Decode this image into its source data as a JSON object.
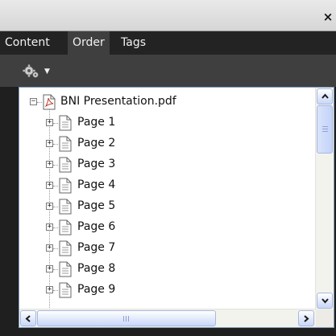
{
  "window": {
    "close_glyph": "×"
  },
  "tabs": [
    {
      "label": "Content",
      "active": false
    },
    {
      "label": "Order",
      "active": true
    },
    {
      "label": "Tags",
      "active": false
    }
  ],
  "toolbar": {
    "options_icon": "gear-icon",
    "caret_glyph": "▼"
  },
  "tree": {
    "root": {
      "label": "BNI Presentation.pdf",
      "expander": "−",
      "icon": "pdf-file-icon"
    },
    "items": [
      {
        "label": "Page 1",
        "expander": "+"
      },
      {
        "label": "Page 2",
        "expander": "+"
      },
      {
        "label": "Page 3",
        "expander": "+"
      },
      {
        "label": "Page 4",
        "expander": "+"
      },
      {
        "label": "Page 5",
        "expander": "+"
      },
      {
        "label": "Page 6",
        "expander": "+"
      },
      {
        "label": "Page 7",
        "expander": "+"
      },
      {
        "label": "Page 8",
        "expander": "+"
      },
      {
        "label": "Page 9",
        "expander": "+"
      }
    ]
  },
  "colors": {
    "panel_bg": "#1f1f1f",
    "tab_active_bg": "#3f3f3f",
    "tree_border": "#7f9db9",
    "scrollbar_accent": "#c8d6f7"
  }
}
